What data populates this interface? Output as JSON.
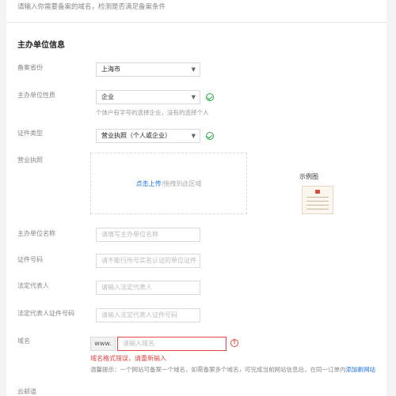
{
  "top_hint": "请输入你需要备案的域名，检测是否满足备案条件",
  "section_title": "主办单位信息",
  "fields": {
    "province": {
      "label": "备案省份",
      "value": "上海市"
    },
    "nature": {
      "label": "主办单位性质",
      "value": "企业",
      "hint": "个体户有字号的选择企业，没有的选择个人"
    },
    "cert_type": {
      "label": "证件类型",
      "value": "营业执照（个人或企业）"
    },
    "license": {
      "label": "营业执照",
      "upload_link": "点击上传",
      "upload_text": "/拖拽到此区域",
      "example_label": "示例图"
    },
    "org_name": {
      "label": "主办单位名称",
      "placeholder": "请填写主办单位名称"
    },
    "cert_no": {
      "label": "证件号码",
      "placeholder": "请不能行所号实名认证的单位证件"
    },
    "legal_rep": {
      "label": "法定代表人",
      "placeholder": "请输入法定代表人"
    },
    "legal_rep_id": {
      "label": "法定代表人证件号码",
      "placeholder": "请输入法定代表人证件号码"
    },
    "domain": {
      "label": "域名",
      "prefix": "www.",
      "placeholder": "请输入域名",
      "error": "域名格式错误，请重新输入",
      "tip": "温馨提示：一个网站可备案一个域名，如需备案多个域名，可完成当前网站信息后，在同一订单内",
      "tip_link": "添加新网站"
    },
    "next_label": "云邮道"
  },
  "icons": {
    "caret": "chevron-down-icon",
    "check": "check-circle-icon",
    "error": "error-circle-icon"
  },
  "colors": {
    "success": "#29a745",
    "error": "#e54545",
    "link": "#1a73e8"
  }
}
